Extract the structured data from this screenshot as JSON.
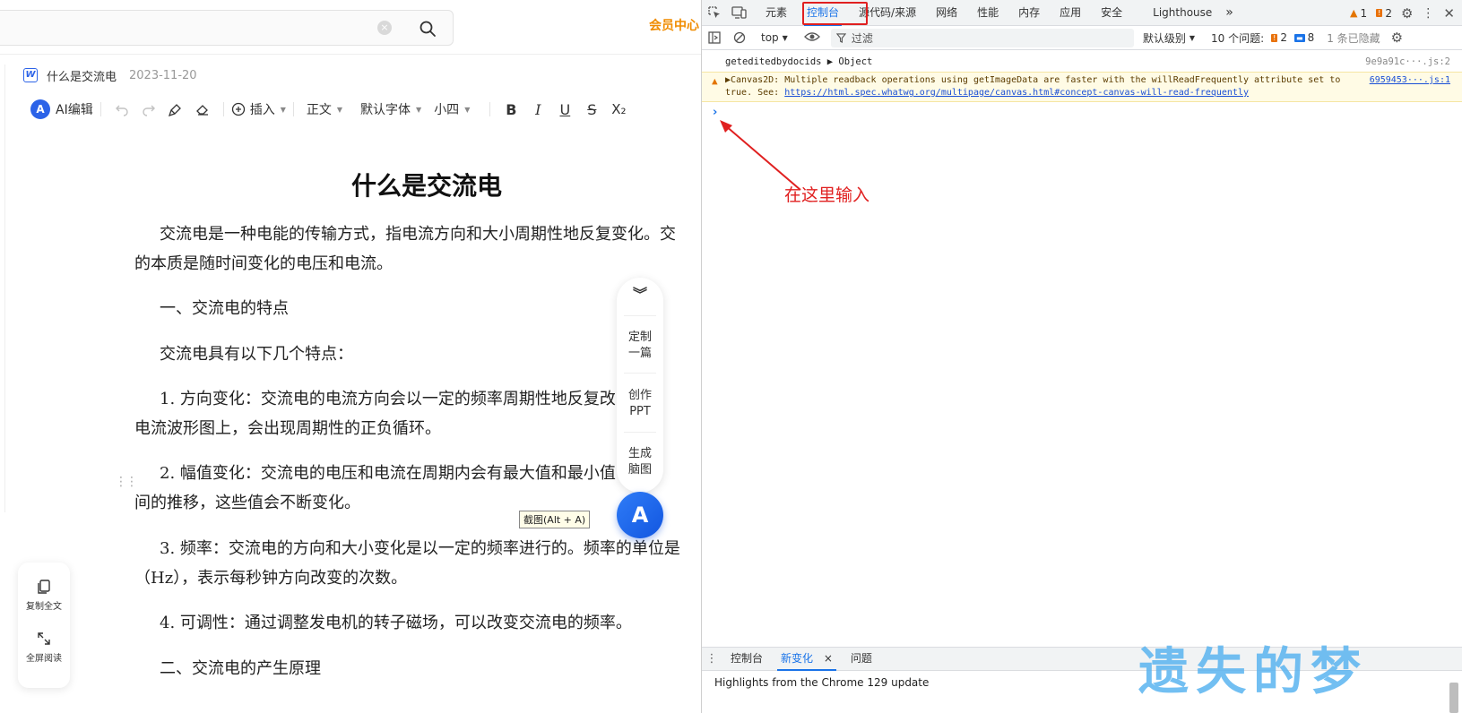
{
  "editor": {
    "member_center": "会员中心",
    "search_clear": "×",
    "doc_name": "什么是交流电",
    "doc_date": "2023-11-20",
    "word_icon": "W",
    "toolbar": {
      "ai_logo": "A",
      "ai_edit": "AI编辑",
      "insert": "插入",
      "paragraph_style": "正文",
      "font_family": "默认字体",
      "font_size": "小四",
      "bold": "B",
      "italic": "I",
      "underline": "U",
      "strike": "S",
      "subscript": "X₂"
    },
    "title": "什么是交流电",
    "paragraphs": [
      "交流电是一种电能的传输方式，指电流方向和大小周期性地反复变化。交",
      "的本质是随时间变化的电压和电流。",
      "一、交流电的特点",
      "交流电具有以下几个特点：",
      "1. 方向变化：交流电的电流方向会以一定的频率周期性地反复改",
      "电流波形图上，会出现周期性的正负循环。",
      "2. 幅值变化：交流电的电压和电流在周期内会有最大值和最小值",
      "间的推移，这些值会不断变化。",
      "3. 频率：交流电的方向和大小变化是以一定的频率进行的。频率的单位是",
      "（Hz），表示每秒钟方向改变的次数。",
      "4. 可调性：通过调整发电机的转子磁场，可以改变交流电的频率。",
      "二、交流电的产生原理"
    ],
    "float_panel": {
      "collapse": "︾",
      "custom_a": "定制",
      "custom_b": "一篇",
      "ppt_a": "创作",
      "ppt_b": "PPT",
      "mind_a": "生成",
      "mind_b": "脑图"
    },
    "ai_bubble": "A",
    "tooltip": "截图(Alt + A)",
    "side": {
      "copy_all": "复制全文",
      "fullscreen": "全屏阅读"
    }
  },
  "devtools": {
    "tabs": [
      "元素",
      "控制台",
      "源代码/来源",
      "网络",
      "性能",
      "内存",
      "应用",
      "安全",
      "Lighthouse"
    ],
    "more_tabs": "»",
    "warn_count": "1",
    "error_count": "2",
    "context": "top",
    "filter_placeholder": "过滤",
    "level": "默认级别",
    "issues_label": "10 个问题:",
    "issues_warn": "2",
    "issues_info": "8",
    "hidden": "1 条已隐藏",
    "log_line": {
      "text": "geteditedbydocids  ▶ Object",
      "source": "9e9a91c···.js:2"
    },
    "warning": {
      "line1": "▶Canvas2D: Multiple readback operations using getImageData are faster with the willReadFrequently attribute set to",
      "line2": "true. See: ",
      "link": "https://html.spec.whatwg.org/multipage/canvas.html#concept-canvas-will-read-frequently",
      "source": "6959453···.js:1"
    },
    "prompt": "›",
    "annotation": "在这里输入",
    "drawer": {
      "tab_console": "控制台",
      "tab_whats_new": "新变化",
      "tab_issues": "问题",
      "close": "×",
      "highlights": "Highlights from the Chrome 129 update"
    },
    "watermark": "遗失的梦"
  },
  "colors": {
    "accent": "#1a73e8",
    "annotation": "#e02020",
    "member": "#f08c00",
    "ai_blue": "#2c63e8",
    "watermark": "#5ab4f0"
  }
}
